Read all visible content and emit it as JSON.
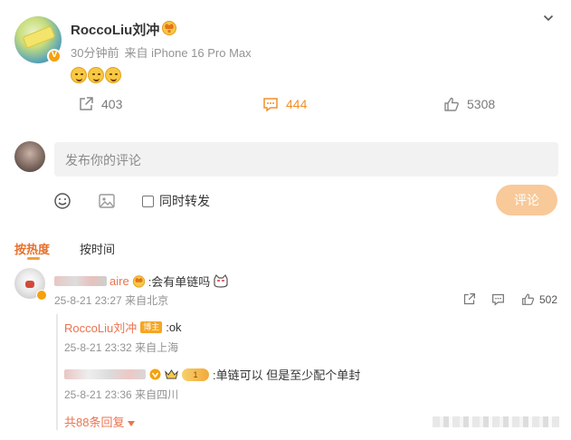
{
  "post": {
    "author": "RoccoLiu刘冲",
    "time": "30分钟前",
    "source": "来自 iPhone 16 Pro Max",
    "emojis": [
      "smile-emoji",
      "grin-emoji",
      "blush-emoji"
    ]
  },
  "actions": {
    "repost_count": "403",
    "comment_count": "444",
    "like_count": "5308"
  },
  "composer": {
    "placeholder": "发布你的评论",
    "repost_checkbox_label": "同时转发",
    "send_label": "评论"
  },
  "sort_tabs": {
    "hot": "按热度",
    "time": "按时间"
  },
  "comment": {
    "name_suffix": "aire",
    "text": ":会有单链吗",
    "time": "25-8-21 23:27",
    "location": "来自北京",
    "like_count": "502"
  },
  "replies": [
    {
      "name": "RoccoLiu刘冲",
      "tag": "博主",
      "text": ":ok",
      "time": "25-8-21 23:32",
      "location": "来自上海"
    },
    {
      "level": "1",
      "text": ":单链可以 但是至少配个单封",
      "time": "25-8-21 23:36",
      "location": "来自四川"
    }
  ],
  "more_replies": "共88条回复",
  "colors": {
    "accent_orange": "#f28f2b",
    "name_link": "#eb7350",
    "send_button_disabled": "#f8c999"
  }
}
